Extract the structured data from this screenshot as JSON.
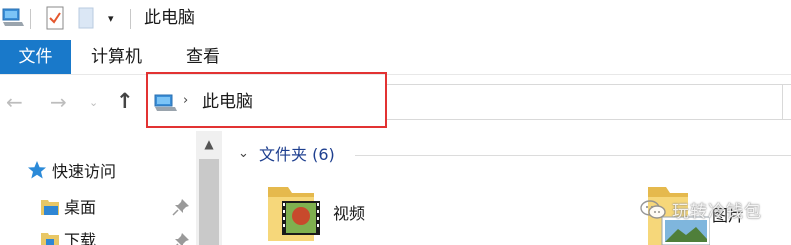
{
  "window": {
    "title": "此电脑"
  },
  "quick_access_toolbar": {
    "dropdown": "▾"
  },
  "ribbon": {
    "tabs": [
      {
        "label": "文件",
        "active": true
      },
      {
        "label": "计算机"
      },
      {
        "label": "查看"
      }
    ]
  },
  "navigation": {
    "back_icon": "←",
    "forward_icon": "→",
    "recent_icon": "⌄",
    "up_icon": "↑"
  },
  "address_bar": {
    "separator": "›",
    "path": [
      "此电脑"
    ],
    "highlight_color": "#e23232"
  },
  "nav_pane": {
    "quick_access": "快速访问",
    "items": [
      {
        "label": "桌面",
        "pinned": true
      },
      {
        "label": "下载",
        "pinned": true
      }
    ]
  },
  "scrollbar": {
    "up_arrow": "▲"
  },
  "content": {
    "group": {
      "chevron": "⌄",
      "title": "文件夹 (6)"
    },
    "folders": [
      {
        "label": "视频"
      },
      {
        "label": "图片"
      }
    ]
  },
  "watermark": {
    "text": "玩转冷钱包"
  },
  "colors": {
    "accent": "#1979ca",
    "group_title": "#1e3f8f"
  }
}
